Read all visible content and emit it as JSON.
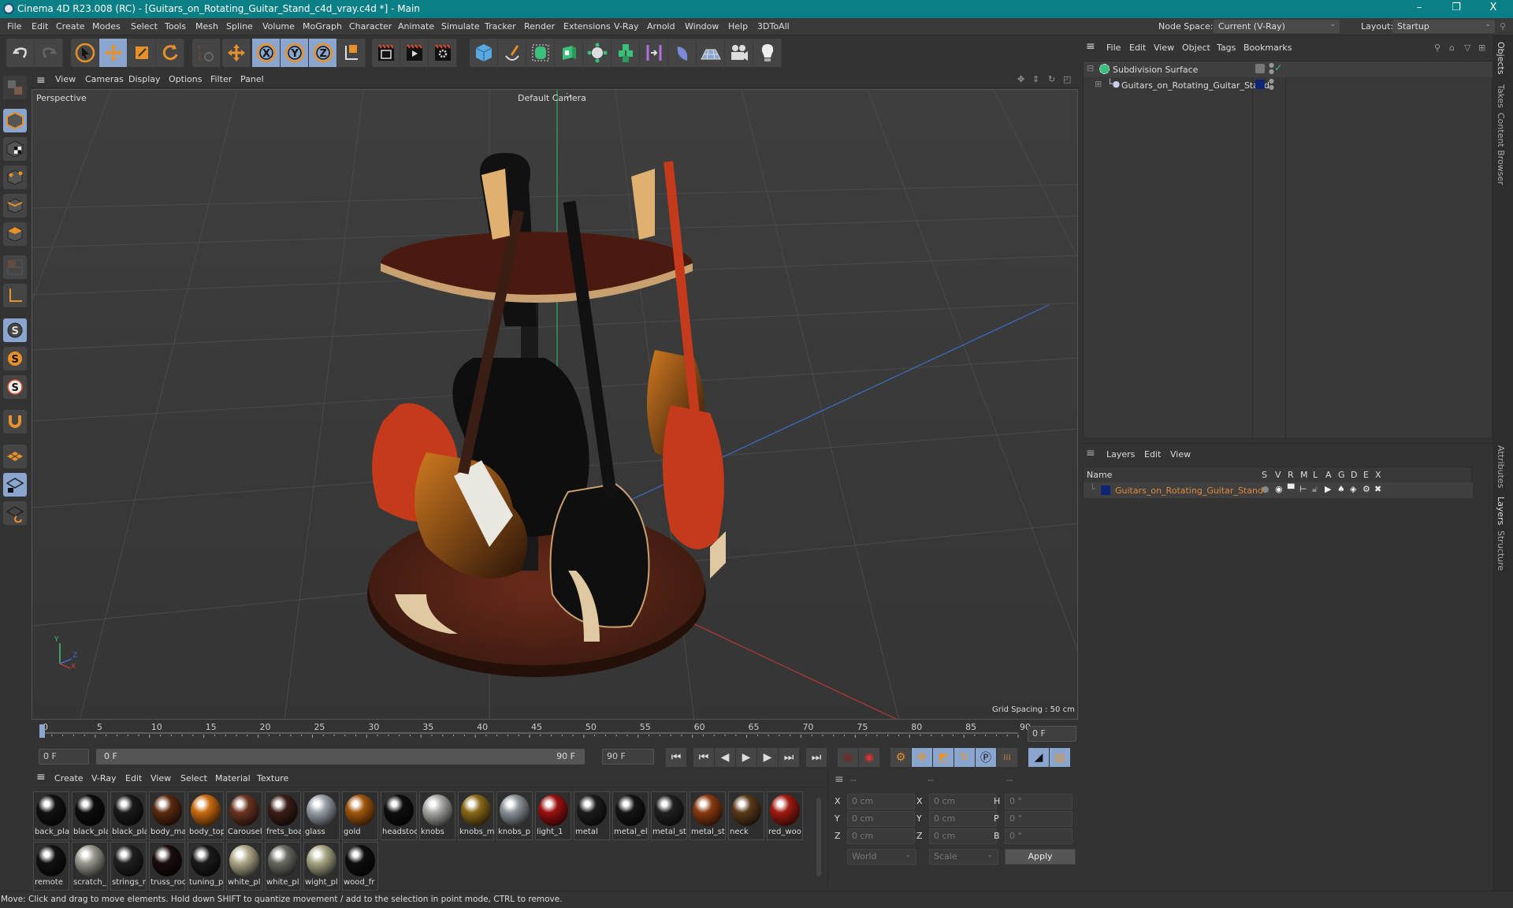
{
  "titlebar": {
    "title": "Cinema 4D R23.008 (RC) - [Guitars_on_Rotating_Guitar_Stand_c4d_vray.c4d *] - Main",
    "minimize": "–",
    "restore": "❐",
    "close": "X"
  },
  "menubar": {
    "items": [
      "File",
      "Edit",
      "Create",
      "Modes",
      "Select",
      "Tools",
      "Mesh",
      "Spline",
      "Volume",
      "MoGraph",
      "Character",
      "Animate",
      "Simulate",
      "Tracker",
      "Render",
      "Extensions",
      "V-Ray",
      "Arnold",
      "Window",
      "Help",
      "3DToAll"
    ],
    "node_space_label": "Node Space:",
    "node_space_value": "Current (V-Ray)",
    "layout_label": "Layout:",
    "layout_value": "Startup"
  },
  "toolbar": {
    "icons": [
      "undo-icon",
      "redo-icon",
      "select-icon",
      "move-icon",
      "scale-icon",
      "rotate-icon",
      "psr-icon",
      "transform-icon",
      "x-axis-icon",
      "y-axis-icon",
      "z-axis-icon",
      "coordinate-system-icon",
      "render-view-icon",
      "render-picture-viewer-icon",
      "render-settings-icon",
      "cube-icon",
      "pen-icon",
      "subdivision-icon",
      "extrude-icon",
      "mograph-cloner-icon",
      "array-icon",
      "deformer-icon",
      "spline-mask-icon",
      "floor-icon",
      "camera-icon",
      "light-icon"
    ]
  },
  "viewport": {
    "menu": [
      "View",
      "Cameras",
      "Display",
      "Options",
      "Filter",
      "Panel"
    ],
    "label": "Perspective",
    "camera": "Default Camera",
    "grid_spacing": "Grid Spacing : 50 cm",
    "axis": {
      "y": "Y",
      "z": "Z",
      "x": "X"
    }
  },
  "timeline": {
    "ticks": [
      "0",
      "5",
      "10",
      "15",
      "20",
      "25",
      "30",
      "35",
      "40",
      "45",
      "50",
      "55",
      "60",
      "65",
      "70",
      "75",
      "80",
      "85",
      "90"
    ],
    "current_frame": "0 F"
  },
  "transport": {
    "start": "0 F",
    "range_start": "0 F",
    "range_end": "90 F",
    "end": "90 F"
  },
  "materials": {
    "menu": [
      "Create",
      "V-Ray",
      "Edit",
      "View",
      "Select",
      "Material",
      "Texture"
    ],
    "items": [
      {
        "name": "back_pla",
        "color": "#111"
      },
      {
        "name": "black_pla",
        "color": "#0d0d0d"
      },
      {
        "name": "black_pla",
        "color": "#1a1a1a"
      },
      {
        "name": "body_ma",
        "color": "#5a2a10"
      },
      {
        "name": "body_top",
        "color": "#c96a10"
      },
      {
        "name": "Carousel",
        "color": "#6a3420"
      },
      {
        "name": "frets_boa",
        "color": "#3a1e16"
      },
      {
        "name": "glass",
        "color": "#9aa0a8"
      },
      {
        "name": "gold",
        "color": "#a0560e"
      },
      {
        "name": "headstoc",
        "color": "#0e0e0e"
      },
      {
        "name": "knobs",
        "color": "#a9a9a5"
      },
      {
        "name": "knobs_m",
        "color": "#8a6a18"
      },
      {
        "name": "knobs_p",
        "color": "#8d939a"
      },
      {
        "name": "light_1",
        "color": "#9a1010"
      },
      {
        "name": "metal",
        "color": "#1c1c1c"
      },
      {
        "name": "metal_el",
        "color": "#151515"
      },
      {
        "name": "metal_st",
        "color": "#202020"
      },
      {
        "name": "metal_st",
        "color": "#8a3a10"
      },
      {
        "name": "neck",
        "color": "#5a3a1a"
      },
      {
        "name": "red_woo",
        "color": "#a01a10"
      },
      {
        "name": "remote",
        "color": "#111"
      },
      {
        "name": "scratch_",
        "color": "#9a9a90"
      },
      {
        "name": "strings_r",
        "color": "#202020"
      },
      {
        "name": "truss_roc",
        "color": "#1a0c0c"
      },
      {
        "name": "tuning_p",
        "color": "#1a1a1a"
      },
      {
        "name": "white_pl",
        "color": "#b0aa8a"
      },
      {
        "name": "white_pl",
        "color": "#6a6a64"
      },
      {
        "name": "wight_pl",
        "color": "#aaa886"
      },
      {
        "name": "wood_fr",
        "color": "#0e0e0e"
      }
    ]
  },
  "coordinates": {
    "header": [
      "--",
      "--",
      "--"
    ],
    "rows": [
      {
        "l1": "X",
        "v1": "0 cm",
        "l2": "X",
        "v2": "0 cm",
        "l3": "H",
        "v3": "0 °"
      },
      {
        "l1": "Y",
        "v1": "0 cm",
        "l2": "Y",
        "v2": "0 cm",
        "l3": "P",
        "v3": "0 °"
      },
      {
        "l1": "Z",
        "v1": "0 cm",
        "l2": "Z",
        "v2": "0 cm",
        "l3": "B",
        "v3": "0 °"
      }
    ],
    "mode": "World",
    "size_mode": "Scale",
    "apply": "Apply"
  },
  "objects": {
    "menu": [
      "File",
      "Edit",
      "View",
      "Object",
      "Tags",
      "Bookmarks"
    ],
    "items": [
      {
        "name": "Subdivision Surface"
      },
      {
        "name": "Guitars_on_Rotating_Guitar_Stand",
        "layer_color": "#0e2475"
      }
    ]
  },
  "layers": {
    "menu": [
      "Layers",
      "Edit",
      "View"
    ],
    "columns": [
      "Name",
      "S",
      "V",
      "R",
      "M",
      "L",
      "A",
      "G",
      "D",
      "E",
      "X"
    ],
    "items": [
      {
        "name": "Guitars_on_Rotating_Guitar_Stand",
        "color": "#0e2475",
        "text_color": "#e08a3a"
      }
    ]
  },
  "sidetabs": {
    "top": [
      "Objects",
      "Takes",
      "Content Browser"
    ],
    "bottom": [
      "Attributes",
      "Layers",
      "Structure"
    ]
  },
  "status": "Move: Click and drag to move elements. Hold down SHIFT to quantize movement / add to the selection in point mode, CTRL to remove.",
  "colors": {
    "titlebar": "#0a7f85",
    "accent_orange": "#e8912a",
    "selected_blue": "#8aa6cf"
  }
}
